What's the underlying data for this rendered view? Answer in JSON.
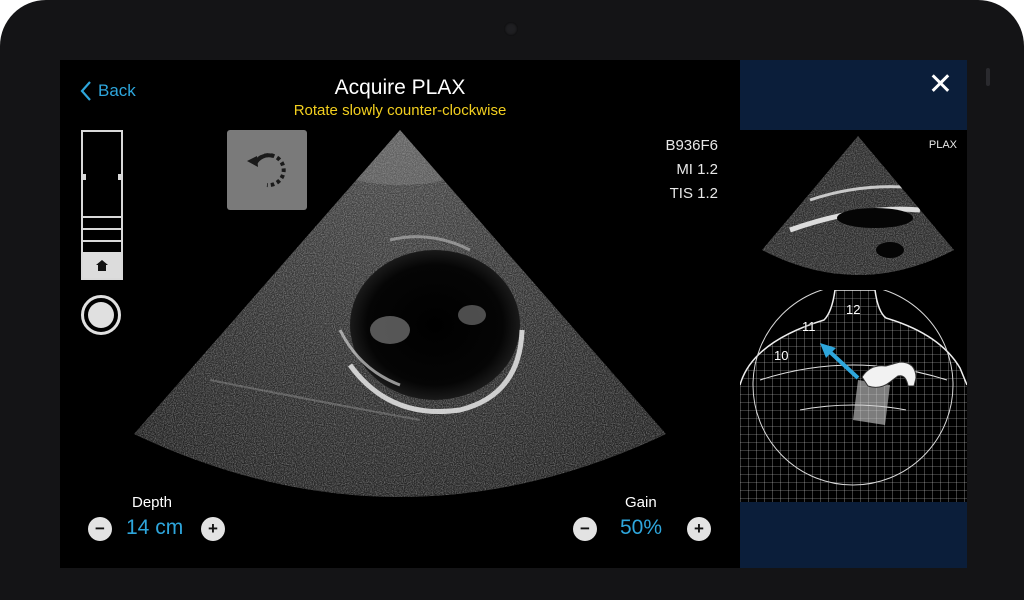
{
  "nav": {
    "back_label": "Back"
  },
  "header": {
    "title": "Acquire PLAX",
    "instruction": "Rotate slowly counter-clockwise"
  },
  "info": {
    "probe_id": "B936F6",
    "mi": "MI 1.2",
    "tis": "TIS 1.2"
  },
  "controls": {
    "depth": {
      "label": "Depth",
      "value": "14 cm"
    },
    "gain": {
      "label": "Gain",
      "value": "50%"
    },
    "minus_symbol": "−",
    "plus_symbol": "+"
  },
  "panel": {
    "close_symbol": "✕",
    "view_label": "PLAX",
    "guide_numbers": [
      "12",
      "11",
      "10"
    ]
  },
  "colors": {
    "accent": "#2ea6dc",
    "instruction": "#f2cf1f",
    "panel": "#0b1e3a"
  },
  "icons": [
    "chevron-left-icon",
    "rotate-counter-clockwise-icon",
    "home-icon",
    "close-icon",
    "direction-arrow-icon",
    "probe-icon"
  ]
}
